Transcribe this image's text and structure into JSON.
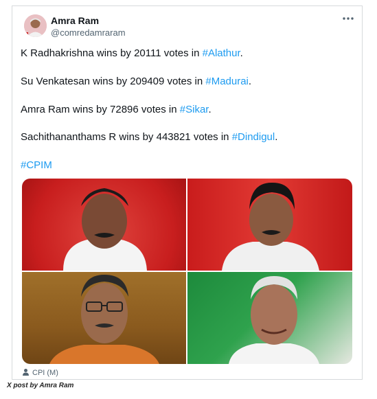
{
  "post": {
    "author_name": "Amra Ram",
    "author_handle": "@comredamraram",
    "more_icon": "more-horizontal-icon",
    "lines": [
      {
        "text": "K Radhakrishna wins by 20111 votes in ",
        "tag": "#Alathur",
        "end": "."
      },
      {
        "text": "Su Venkatesan wins by 209409 votes in ",
        "tag": "#Madurai",
        "end": "."
      },
      {
        "text": "Amra Ram wins by 72896 votes in ",
        "tag": "#Sikar",
        "end": "."
      },
      {
        "text": "Sachithananthams R wins by 443821 votes in ",
        "tag": "#Dindigul",
        "end": "."
      }
    ],
    "hashtag": "#CPIM",
    "source_label": "CPI (M)",
    "link_color": "#1d9bf0"
  },
  "caption": "X post by Amra Ram"
}
